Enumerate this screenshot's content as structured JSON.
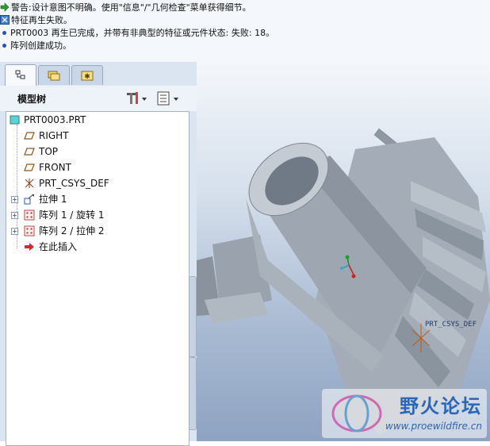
{
  "messages": [
    {
      "icon": "warning-arrow-icon",
      "text": "警告:设计意图不明确。使用\"信息\"/\"几何检查\"菜单获得细节。"
    },
    {
      "icon": "feature-icon",
      "text": "特征再生失败。"
    },
    {
      "icon": "bullet-icon",
      "text": "PRT0003 再生已完成，并带有非典型的特征或元件状态: 失败: 18。"
    },
    {
      "icon": "bullet-icon",
      "text": "阵列创建成功。"
    }
  ],
  "tabs": [
    {
      "name": "model-tree-tab",
      "icon": "tree-icon"
    },
    {
      "name": "folder-browser-tab",
      "icon": "folders-icon"
    },
    {
      "name": "favorites-tab",
      "icon": "star-folder-icon"
    }
  ],
  "model_tree": {
    "title": "模型树",
    "settings_icon": "tools-icon",
    "show_icon": "list-icon",
    "items": [
      {
        "label": "PRT0003.PRT",
        "icon": "part-icon",
        "expandable": false
      },
      {
        "label": "RIGHT",
        "icon": "datum-plane-icon",
        "expandable": false
      },
      {
        "label": "TOP",
        "icon": "datum-plane-icon",
        "expandable": false
      },
      {
        "label": "FRONT",
        "icon": "datum-plane-icon",
        "expandable": false
      },
      {
        "label": "PRT_CSYS_DEF",
        "icon": "coordinate-system-icon",
        "expandable": false
      },
      {
        "label": "拉伸 1",
        "icon": "extrude-icon",
        "expandable": true
      },
      {
        "label": "阵列 1 / 旋转 1",
        "icon": "pattern-icon",
        "expandable": true
      },
      {
        "label": "阵列 2 / 拉伸 2",
        "icon": "pattern-icon",
        "expandable": true
      },
      {
        "label": "在此插入",
        "icon": "insert-arrow-icon",
        "expandable": false
      }
    ]
  },
  "viewport": {
    "csys_label": "PRT_CSYS_DEF",
    "model_color": "#9aa3ad",
    "background_top": "#f4f7fb",
    "background_bottom": "#8ea3c2"
  },
  "watermark": {
    "title": "野火论坛",
    "url": "www.proewildfire.cn"
  }
}
